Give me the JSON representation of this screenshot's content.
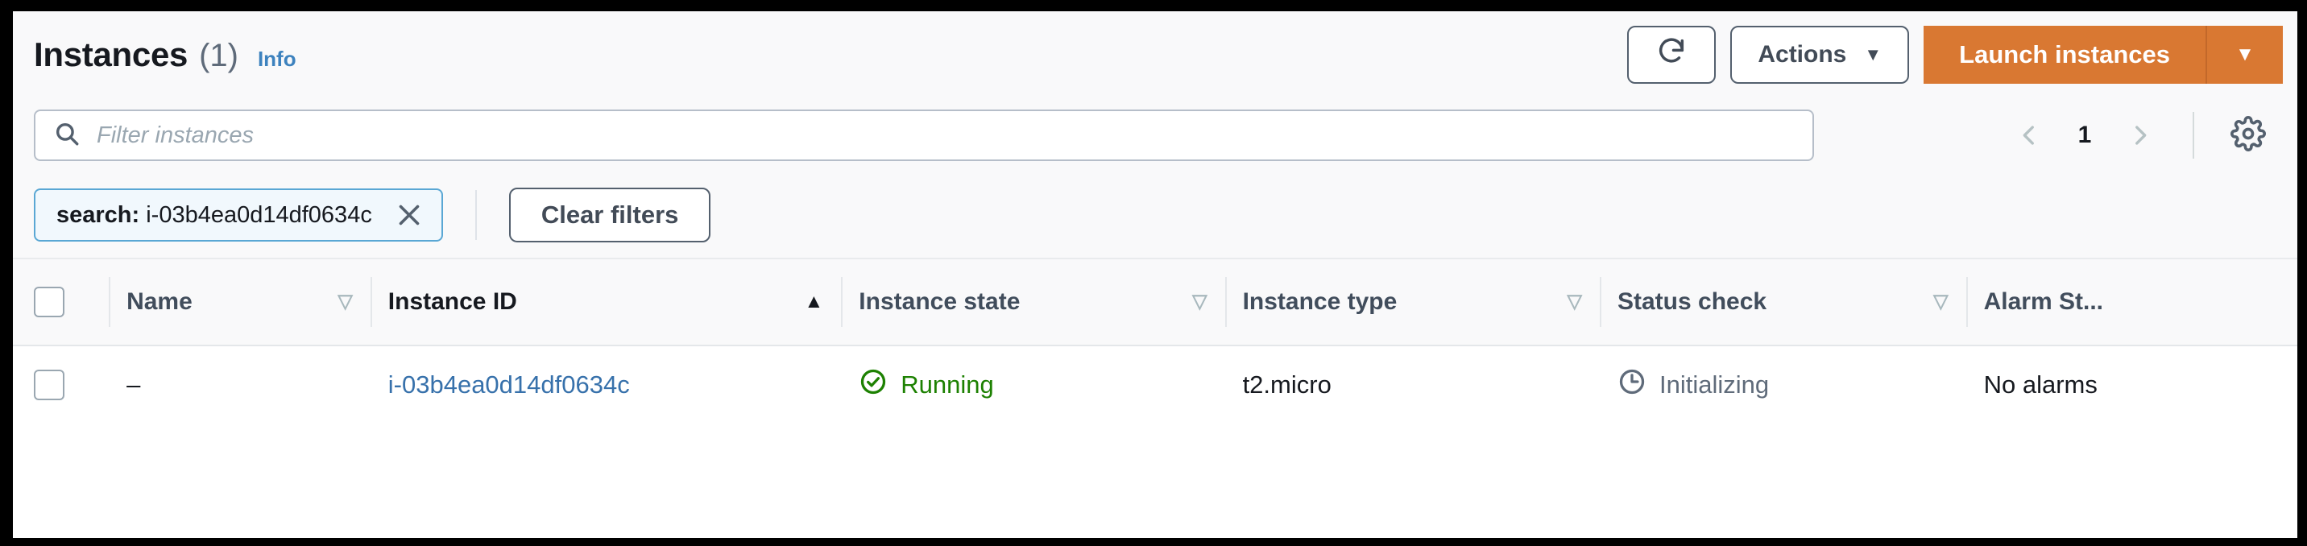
{
  "header": {
    "title": "Instances",
    "count": "(1)",
    "info_label": "Info",
    "refresh_icon": "refresh-icon",
    "actions_label": "Actions",
    "launch_label": "Launch instances",
    "caret_glyph": "▼",
    "accent_orange": "#d97832",
    "link_blue": "#3d82be"
  },
  "search": {
    "placeholder": "Filter instances",
    "value": "",
    "search_icon": "search-icon"
  },
  "pagination": {
    "prev_glyph": "‹",
    "page": "1",
    "next_glyph": "›",
    "settings_icon": "gear-icon"
  },
  "filters": {
    "token_prefix": "search:",
    "token_value": "i-03b4ea0d14df0634c",
    "remove_glyph": "✕",
    "clear_label": "Clear filters"
  },
  "table": {
    "columns": [
      {
        "label": "Name",
        "sort": "inactive",
        "sort_glyph": "▽"
      },
      {
        "label": "Instance ID",
        "sort": "asc",
        "sort_glyph": "▲"
      },
      {
        "label": "Instance state",
        "sort": "inactive",
        "sort_glyph": "▽"
      },
      {
        "label": "Instance type",
        "sort": "inactive",
        "sort_glyph": "▽"
      },
      {
        "label": "Status check",
        "sort": "inactive",
        "sort_glyph": "▽"
      },
      {
        "label": "Alarm St...",
        "sort": "none",
        "sort_glyph": ""
      }
    ],
    "rows": [
      {
        "name": "–",
        "instance_id": "i-03b4ea0d14df0634c",
        "instance_state": "Running",
        "state_icon": "status-positive-icon",
        "instance_type": "t2.micro",
        "status_check": "Initializing",
        "status_icon": "pending-clock-icon",
        "alarm_status": "No alarms"
      }
    ]
  }
}
